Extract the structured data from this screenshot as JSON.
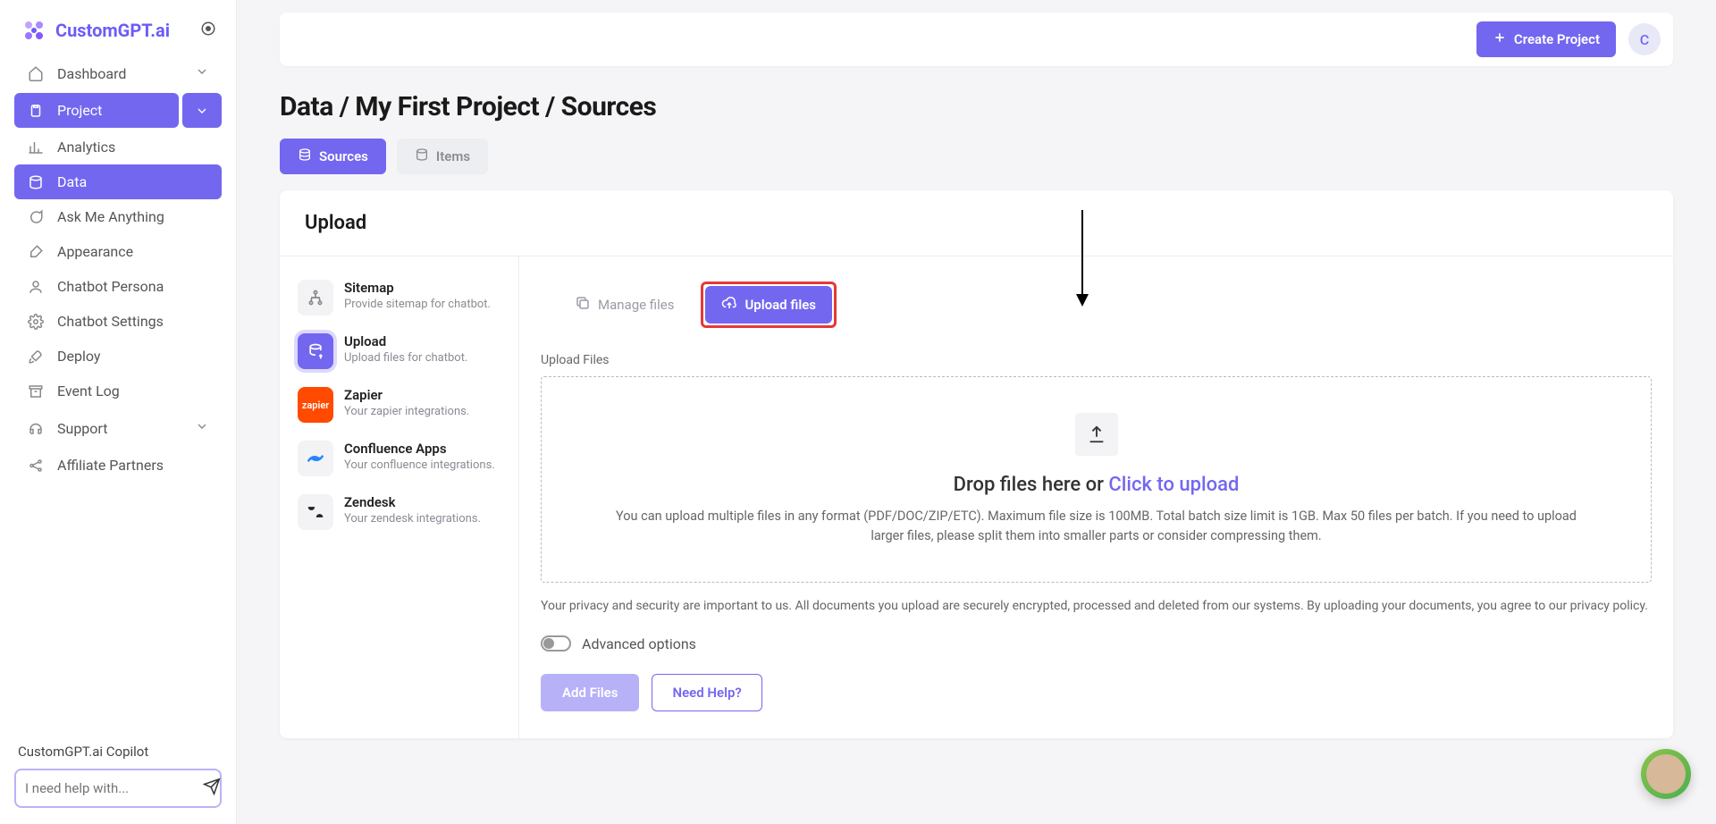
{
  "brand": "CustomGPT.ai",
  "header": {
    "create_project": "Create Project",
    "avatar_initial": "C"
  },
  "nav": {
    "dashboard": "Dashboard",
    "project": "Project",
    "analytics": "Analytics",
    "data": "Data",
    "ask": "Ask Me Anything",
    "appearance": "Appearance",
    "persona": "Chatbot Persona",
    "settings": "Chatbot Settings",
    "deploy": "Deploy",
    "eventlog": "Event Log",
    "support": "Support",
    "affiliates": "Affiliate Partners"
  },
  "copilot": {
    "title": "CustomGPT.ai Copilot",
    "placeholder": "I need help with..."
  },
  "breadcrumb": "Data / My First Project / Sources",
  "tabs": {
    "sources": "Sources",
    "items": "Items"
  },
  "card": {
    "title": "Upload"
  },
  "sources": {
    "sitemap": {
      "title": "Sitemap",
      "desc": "Provide sitemap for chatbot."
    },
    "upload": {
      "title": "Upload",
      "desc": "Upload files for chatbot."
    },
    "zapier": {
      "title": "Zapier",
      "desc": "Your zapier integrations."
    },
    "confluence": {
      "title": "Confluence Apps",
      "desc": "Your confluence integrations."
    },
    "zendesk": {
      "title": "Zendesk",
      "desc": "Your zendesk integrations."
    }
  },
  "pane": {
    "manage_files": "Manage files",
    "upload_files": "Upload files",
    "section_label": "Upload Files",
    "drop_prefix": "Drop files here or ",
    "drop_link": "Click to upload",
    "drop_sub": "You can upload multiple files in any format (PDF/DOC/ZIP/ETC). Maximum file size is 100MB. Total batch size limit is 1GB. Max 50 files per batch. If you need to upload larger files, please split them into smaller parts or consider compressing them.",
    "privacy": "Your privacy and security are important to us. All documents you upload are securely encrypted, processed and deleted from our systems. By uploading your documents, you agree to our privacy policy.",
    "advanced": "Advanced options",
    "add_files": "Add Files",
    "need_help": "Need Help?"
  }
}
